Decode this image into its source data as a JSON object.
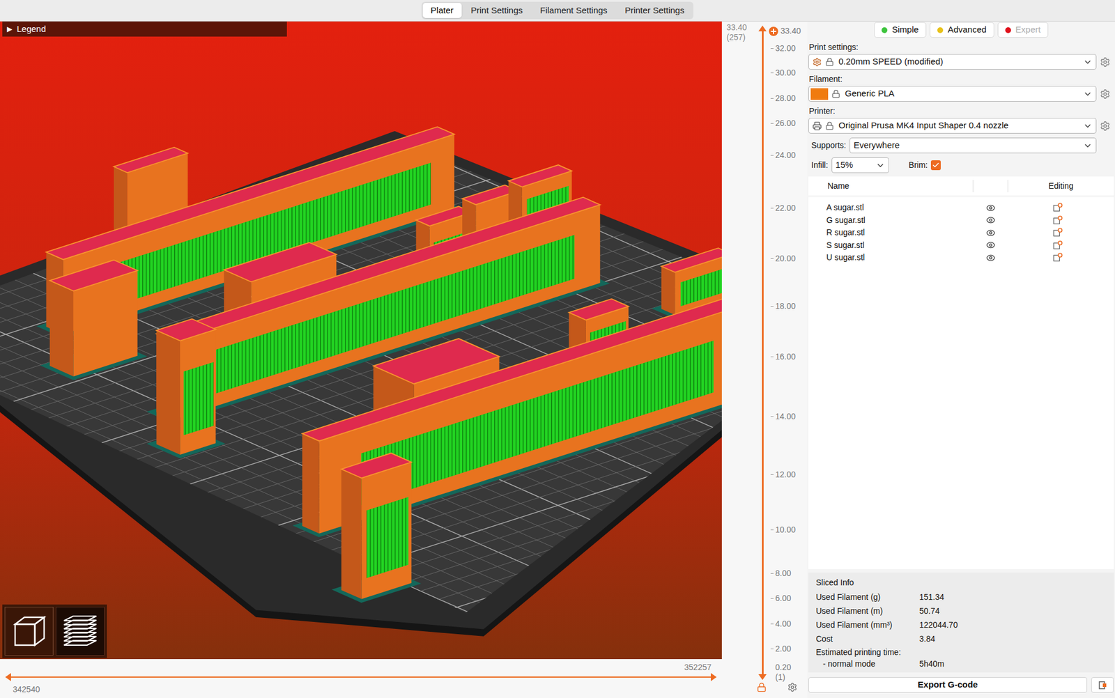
{
  "tabs": [
    {
      "label": "Plater",
      "selected": true
    },
    {
      "label": "Print Settings",
      "selected": false
    },
    {
      "label": "Filament Settings",
      "selected": false
    },
    {
      "label": "Printer Settings",
      "selected": false
    }
  ],
  "viewport": {
    "legend": {
      "arrow": "▶",
      "label": "Legend"
    },
    "view_modes": [
      {
        "kind": "cube",
        "selected": false
      },
      {
        "kind": "layers",
        "selected": true
      }
    ]
  },
  "horizontal_slider": {
    "upper_label": "352257",
    "lower_label": "342540",
    "low_level": 0,
    "high_level": 1
  },
  "vertical_slider": {
    "top_value": "33.40",
    "top_layer": "(257)",
    "ticks": [
      "33.40",
      "32.00",
      "30.00",
      "28.00",
      "26.00",
      "24.00",
      "22.00",
      "20.00",
      "18.00",
      "16.00",
      "14.00",
      "12.00",
      "10.00",
      "8.00",
      "6.00",
      "4.00",
      "2.00"
    ],
    "bottom_value": "0.20",
    "bottom_layer": "(1)",
    "low_level": 0,
    "high_level": 1
  },
  "modes": [
    {
      "label": "Simple",
      "selected": false,
      "color": "#3ec43e"
    },
    {
      "label": "Advanced",
      "selected": false,
      "color": "#e8c21a"
    },
    {
      "label": "Expert",
      "selected": true,
      "color": "#e0101a"
    }
  ],
  "settings": {
    "print": {
      "label": "Print settings:",
      "value": "0.20mm SPEED (modified)"
    },
    "filament": {
      "label": "Filament:",
      "value": "Generic PLA",
      "color": "#f07b0f"
    },
    "printer": {
      "label": "Printer:",
      "value": "Original Prusa MK4 Input Shaper 0.4 nozzle"
    },
    "supports": {
      "label": "Supports:",
      "value": "Everywhere"
    },
    "infill": {
      "label": "Infill:",
      "value": "15%"
    },
    "brim": {
      "label": "Brim:",
      "checked": true
    }
  },
  "object_list": {
    "columns": [
      "Name",
      "Editing"
    ],
    "rows": [
      {
        "name": "A sugar.stl",
        "visible": true
      },
      {
        "name": "G sugar.stl",
        "visible": true
      },
      {
        "name": "R sugar.stl",
        "visible": true
      },
      {
        "name": "S sugar.stl",
        "visible": true
      },
      {
        "name": "U sugar.stl",
        "visible": true
      }
    ]
  },
  "sliced_info": {
    "title": "Sliced Info",
    "rows": [
      {
        "label": "Used Filament (g)",
        "value": "151.34"
      },
      {
        "label": "Used Filament (m)",
        "value": "50.74"
      },
      {
        "label": "Used Filament (mm³)",
        "value": "122044.70"
      },
      {
        "label": "Cost",
        "value": "3.84"
      }
    ],
    "time_label": "Estimated printing time:",
    "time_rows": [
      {
        "label": "- normal mode",
        "value": "5h40m"
      }
    ]
  },
  "export_button": "Export G-code"
}
